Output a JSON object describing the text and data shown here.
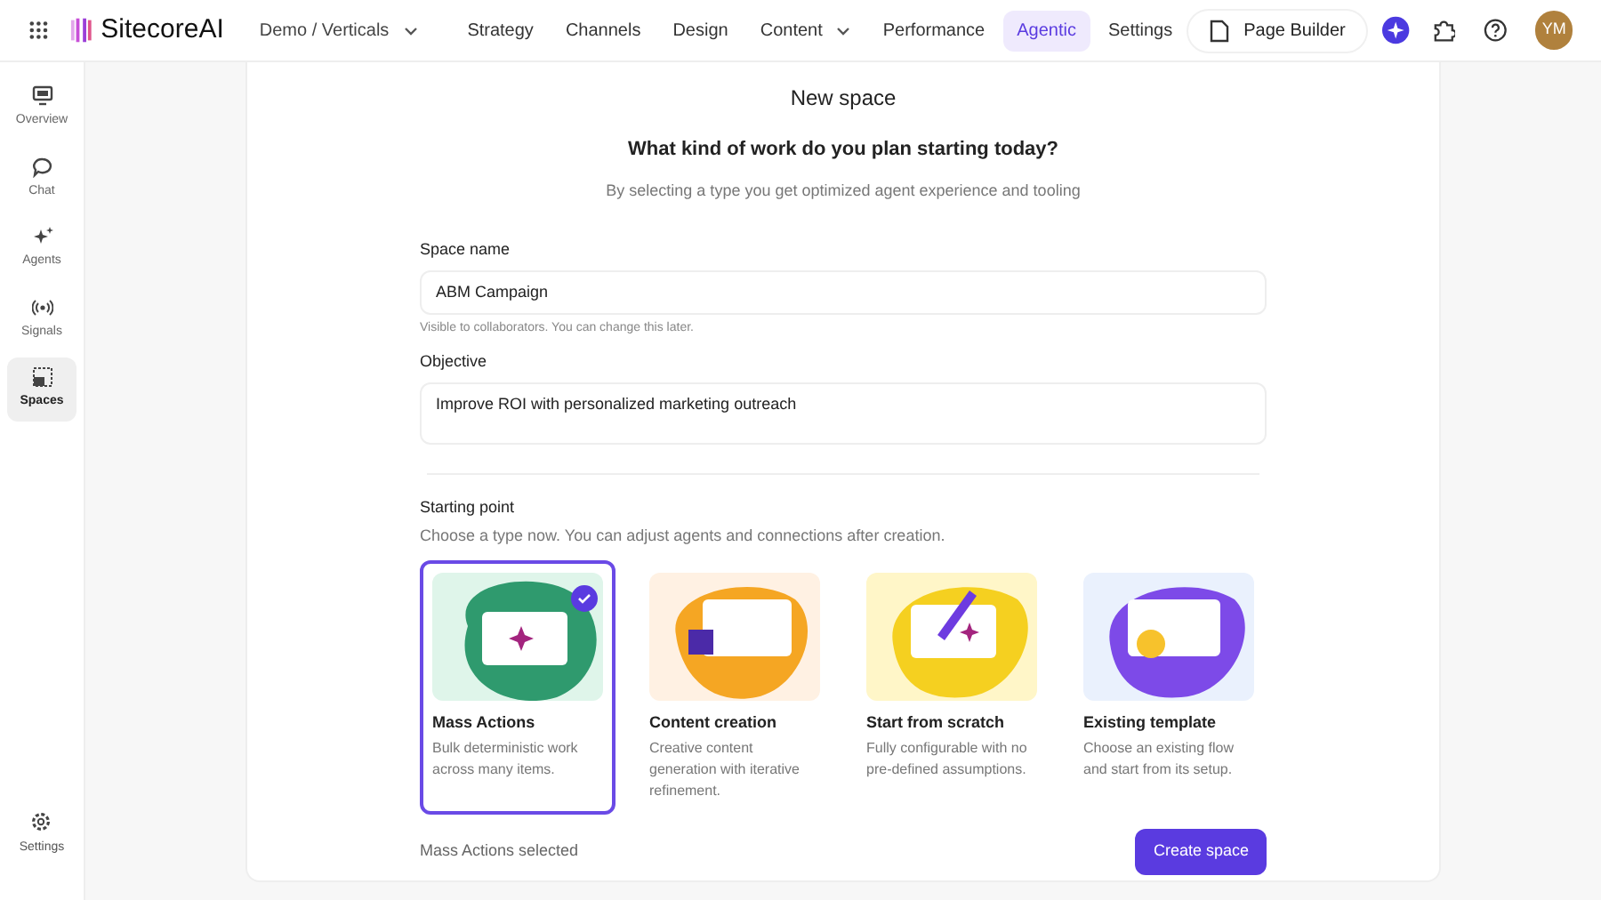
{
  "header": {
    "logo": "SitecoreAI",
    "project": "Demo / Verticals",
    "nav": [
      {
        "label": "Strategy",
        "selected": false,
        "dropdown": false
      },
      {
        "label": "Channels",
        "selected": false,
        "dropdown": false
      },
      {
        "label": "Design",
        "selected": false,
        "dropdown": false
      },
      {
        "label": "Content",
        "selected": false,
        "dropdown": true
      },
      {
        "label": "Performance",
        "selected": false,
        "dropdown": false
      },
      {
        "label": "Agentic",
        "selected": true,
        "dropdown": false
      },
      {
        "label": "Settings",
        "selected": false,
        "dropdown": false
      }
    ],
    "page_builder": "Page Builder",
    "avatar": "YM"
  },
  "sidebar": {
    "items": [
      {
        "label": "Overview",
        "kind": "overview",
        "selected": false
      },
      {
        "label": "Chat",
        "kind": "chat",
        "selected": false
      },
      {
        "label": "Agents",
        "kind": "agents",
        "selected": false
      },
      {
        "label": "Signals",
        "kind": "signals",
        "selected": false
      },
      {
        "label": "Spaces",
        "kind": "spaces",
        "selected": true
      }
    ],
    "footer": {
      "label": "Settings"
    }
  },
  "form": {
    "title": "New space",
    "question": "What kind of work do you plan starting today?",
    "subtitle": "By selecting a type you get optimized agent experience and tooling",
    "space_name": {
      "label": "Space name",
      "value": "ABM Campaign",
      "hint": "Visible to collaborators. You can change this later."
    },
    "objective": {
      "label": "Objective",
      "value": "Improve ROI with personalized marketing outreach"
    },
    "starting_point": {
      "label": "Starting point",
      "hint": "Choose a type now. You can adjust agents and connections after creation.",
      "options": [
        {
          "kind": "mass",
          "title": "Mass Actions",
          "description": "Bulk deterministic work across many items.",
          "selected": true
        },
        {
          "kind": "content",
          "title": "Content creation",
          "description": "Creative content generation with iterative refinement.",
          "selected": false
        },
        {
          "kind": "scratch",
          "title": "Start from scratch",
          "description": "Fully configurable with no pre-defined assumptions.",
          "selected": false
        },
        {
          "kind": "template",
          "title": "Existing template",
          "description": "Choose an existing flow and start from its setup.",
          "selected": false
        }
      ]
    },
    "status": "Mass Actions selected",
    "submit": "Create space"
  }
}
